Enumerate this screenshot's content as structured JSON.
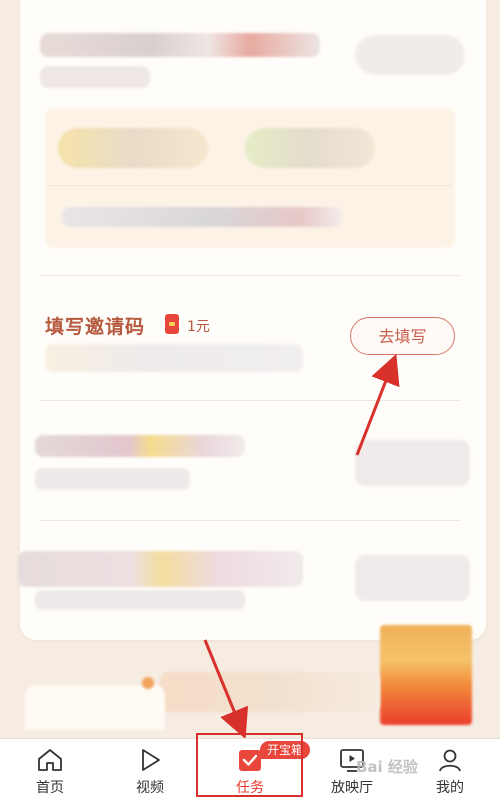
{
  "invite": {
    "title": "填写邀请码",
    "reward_icon": "red-envelope-icon",
    "reward": "1元",
    "button_label": "去填写"
  },
  "nav": {
    "items": [
      {
        "label": "首页",
        "icon": "home-icon"
      },
      {
        "label": "视频",
        "icon": "play-icon"
      },
      {
        "label": "任务",
        "icon": "task-check-icon"
      },
      {
        "label": "放映厅",
        "icon": "screen-play-icon"
      },
      {
        "label": "我的",
        "icon": "user-icon"
      }
    ],
    "badge": "开宝箱"
  },
  "watermark": "Bai 经验",
  "colors": {
    "accent": "#e9463c",
    "title": "#b55a3e",
    "annotation": "#d8302b",
    "background": "#f6ece2"
  }
}
